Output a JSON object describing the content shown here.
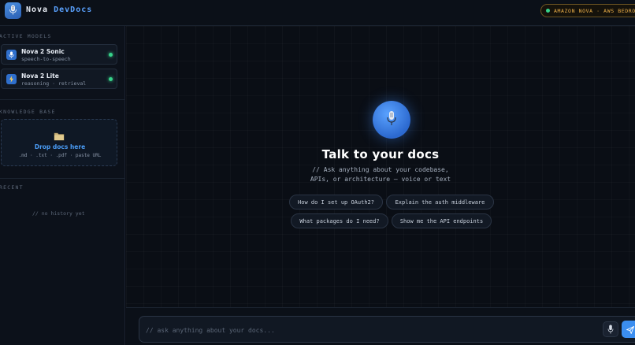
{
  "header": {
    "brand_primary": "Nova",
    "brand_secondary": "DevDocs",
    "badge_text": "AMAZON NOVA · AWS BEDROCK",
    "logo_icon": "microphone-icon"
  },
  "sidebar": {
    "models_label": "ACTIVE MODELS",
    "models": [
      {
        "name": "Nova 2 Sonic",
        "subtitle": "speech-to-speech",
        "icon": "microphone-icon",
        "status_color": "#37d38a"
      },
      {
        "name": "Nova 2 Lite",
        "subtitle": "reasoning · retrieval",
        "icon": "lightning-icon",
        "status_color": "#37d38a"
      }
    ],
    "kb_label": "KNOWLEDGE BASE",
    "dropzone": {
      "icon": "folder-icon",
      "title": "Drop docs here",
      "formats": ".md · .txt · .pdf · paste URL"
    },
    "recent_label": "RECENT",
    "no_history": "// no history yet"
  },
  "main": {
    "orb_icon": "microphone-icon",
    "title": "Talk to your docs",
    "subtitle_line1": "// Ask anything about your codebase,",
    "subtitle_line2": "APIs, or architecture — voice or text",
    "suggestions": [
      "How do I set up OAuth2?",
      "Explain the auth middleware",
      "What packages do I need?",
      "Show me the API endpoints"
    ]
  },
  "input": {
    "placeholder": "// ask anything about your docs...",
    "value": ""
  },
  "colors": {
    "accent": "#3b8ef0",
    "badge": "#f0b24a",
    "online": "#37d38a",
    "background": "#090d14"
  }
}
